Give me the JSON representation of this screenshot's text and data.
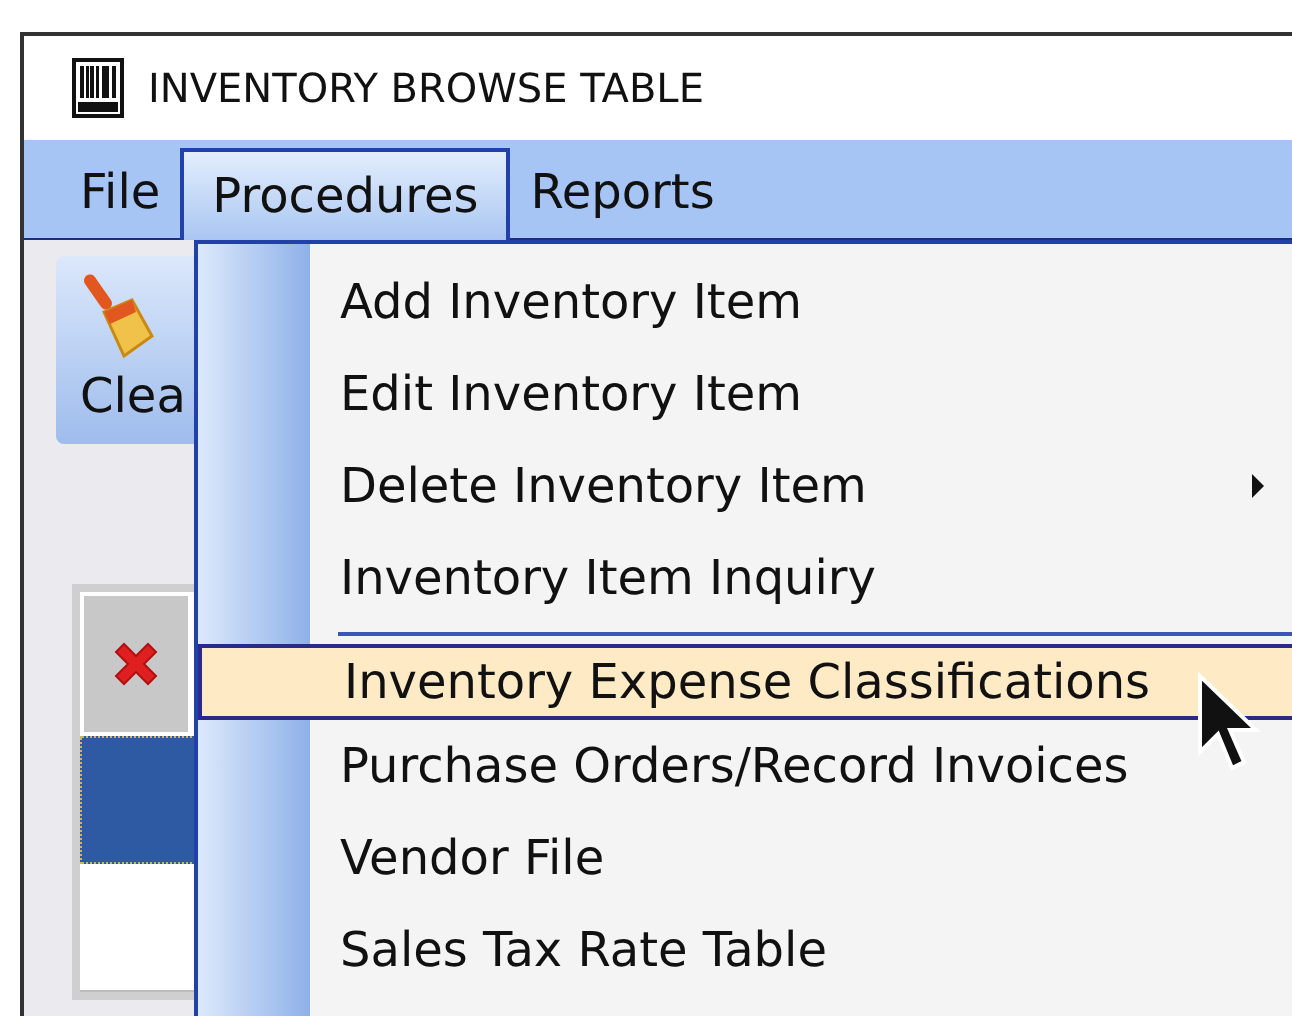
{
  "window": {
    "title": "INVENTORY BROWSE TABLE"
  },
  "menubar": [
    {
      "label": "File",
      "selected": false
    },
    {
      "label": "Procedures",
      "selected": true
    },
    {
      "label": "Reports",
      "selected": false
    }
  ],
  "toolbar": [
    {
      "label": "Clea"
    }
  ],
  "grid": {
    "rows": [
      {
        "selected": true
      },
      {
        "selected": false
      }
    ]
  },
  "menu": [
    {
      "kind": "item",
      "label": "Add Inventory Item",
      "selected": false,
      "submenu": false
    },
    {
      "kind": "item",
      "label": "Edit Inventory Item",
      "selected": false,
      "submenu": false
    },
    {
      "kind": "item",
      "label": "Delete Inventory Item",
      "selected": false,
      "submenu": true
    },
    {
      "kind": "item",
      "label": "Inventory Item Inquiry",
      "selected": false,
      "submenu": false
    },
    {
      "kind": "separator"
    },
    {
      "kind": "item",
      "label": "Inventory Expense Classifications",
      "selected": true,
      "submenu": false
    },
    {
      "kind": "item",
      "label": "Purchase Orders/Record Invoices",
      "selected": false,
      "submenu": false
    },
    {
      "kind": "item",
      "label": "Vendor File",
      "selected": false,
      "submenu": false
    },
    {
      "kind": "item",
      "label": "Sales Tax Rate Table",
      "selected": false,
      "submenu": false
    }
  ]
}
